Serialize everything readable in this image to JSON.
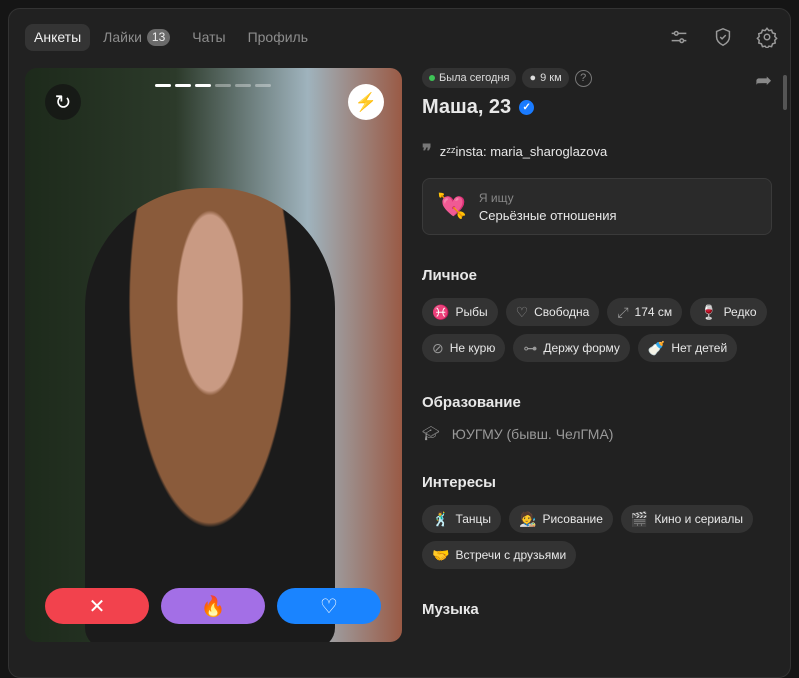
{
  "tabs": [
    {
      "label": "Анкеты",
      "active": true
    },
    {
      "label": "Лайки",
      "badge": "13"
    },
    {
      "label": "Чаты"
    },
    {
      "label": "Профиль"
    }
  ],
  "toolbar": {
    "icons": [
      "filters-icon",
      "shield-check-icon",
      "gear-icon"
    ]
  },
  "photo": {
    "total": 6,
    "current": 3
  },
  "actions": {
    "dislike": "✕",
    "super": "🔥",
    "like": "♡",
    "colors": {
      "dislike": "#f2424d",
      "super": "#a36fe6",
      "like": "#1a84ff"
    }
  },
  "profile": {
    "status": "Была сегодня",
    "distance": "9 км",
    "help": "?",
    "name": "Маша, 23",
    "bio": "zᶻᶻinsta: maria_sharoglazova",
    "seek_label": "Я ищу",
    "seek_value": "Серьёзные отношения",
    "seek_emoji": "💘",
    "personal_title": "Личное",
    "personal": [
      {
        "icon": "♓",
        "label": "Рыбы"
      },
      {
        "icon": "♡",
        "label": "Свободна"
      },
      {
        "icon": "⤢",
        "label": "174 см"
      },
      {
        "icon": "🍷",
        "label": "Редко"
      },
      {
        "icon": "⊘",
        "label": "Не курю"
      },
      {
        "icon": "⊶",
        "label": "Держу форму"
      },
      {
        "icon": "🍼",
        "label": "Нет детей"
      }
    ],
    "education_title": "Образование",
    "education": "ЮУГМУ (бывш. ЧелГМА)",
    "interests_title": "Интересы",
    "interests": [
      {
        "icon": "🕺",
        "label": "Танцы"
      },
      {
        "icon": "🧑‍🎨",
        "label": "Рисование"
      },
      {
        "icon": "🎬",
        "label": "Кино и сериалы"
      },
      {
        "icon": "🤝",
        "label": "Встречи с друзьями"
      }
    ],
    "music_title": "Музыка"
  }
}
